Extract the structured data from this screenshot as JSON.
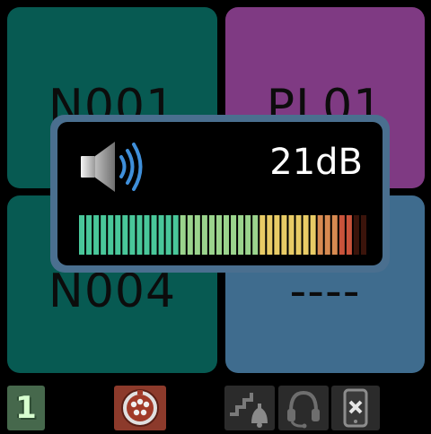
{
  "tiles": [
    {
      "label": "N001",
      "color": "#075a52"
    },
    {
      "label": "PL01",
      "color": "#7f3a83"
    },
    {
      "label": "N004",
      "color": "#075a52"
    },
    {
      "label": "----",
      "color": "#3f6c8e"
    }
  ],
  "volume_overlay": {
    "icon": "speaker-icon",
    "level_text": "21dB",
    "meter": {
      "total_segments": 40,
      "lit_segments": 38,
      "colors": [
        "#49c79a",
        "#9bd48d",
        "#e8cb66",
        "#d78a51",
        "#c9533b",
        "#3b140b"
      ]
    }
  },
  "toolbar": {
    "counter_icon": "counter-one-icon",
    "counter_value": "1",
    "dmx_icon": "dmx-connector-icon",
    "stairs_bell_icon": "stairs-bell-icon",
    "headset_icon": "headset-icon",
    "phone_off_icon": "phone-disabled-icon"
  }
}
